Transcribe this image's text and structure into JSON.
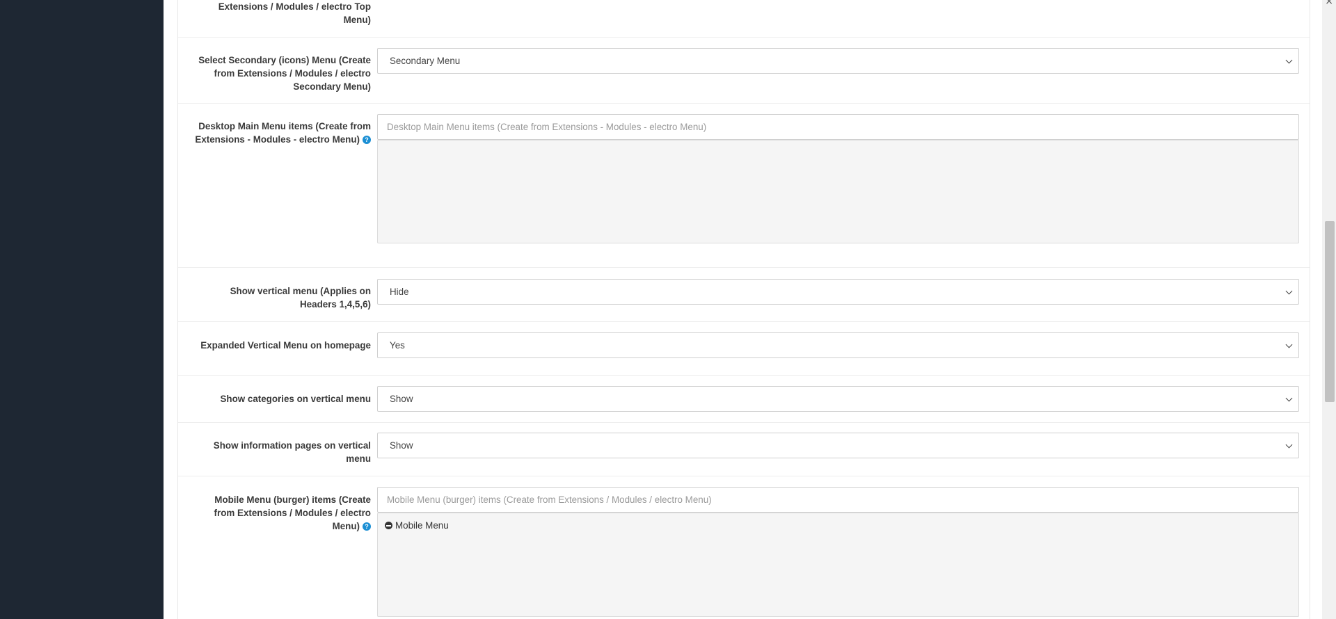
{
  "close_symbol": "×",
  "fields": {
    "top_menu": {
      "label": "Extensions / Modules / electro Top Menu)"
    },
    "secondary_menu": {
      "label": "Select Secondary (icons) Menu (Create from Extensions / Modules / electro Secondary Menu)",
      "value": "Secondary Menu"
    },
    "desktop_main_menu": {
      "label": "Desktop Main Menu items (Create from Extensions - Modules - electro Menu)",
      "placeholder": "Desktop Main Menu items (Create from Extensions - Modules - electro Menu)",
      "help": "?"
    },
    "vertical_menu": {
      "label": "Show vertical menu (Applies on Headers 1,4,5,6)",
      "value": "Hide"
    },
    "expanded_vertical_menu": {
      "label": "Expanded Vertical Menu on homepage",
      "value": "Yes"
    },
    "categories_vertical": {
      "label": "Show categories on vertical menu",
      "value": "Show"
    },
    "information_pages_vertical": {
      "label": "Show information pages on vertical menu",
      "value": "Show"
    },
    "mobile_menu": {
      "label": "Mobile Menu (burger) items (Create from Extensions / Modules / electro Menu)",
      "placeholder": "Mobile Menu (burger) items (Create from Extensions / Modules / electro Menu)",
      "help": "?",
      "items": [
        "Mobile Menu"
      ]
    }
  }
}
